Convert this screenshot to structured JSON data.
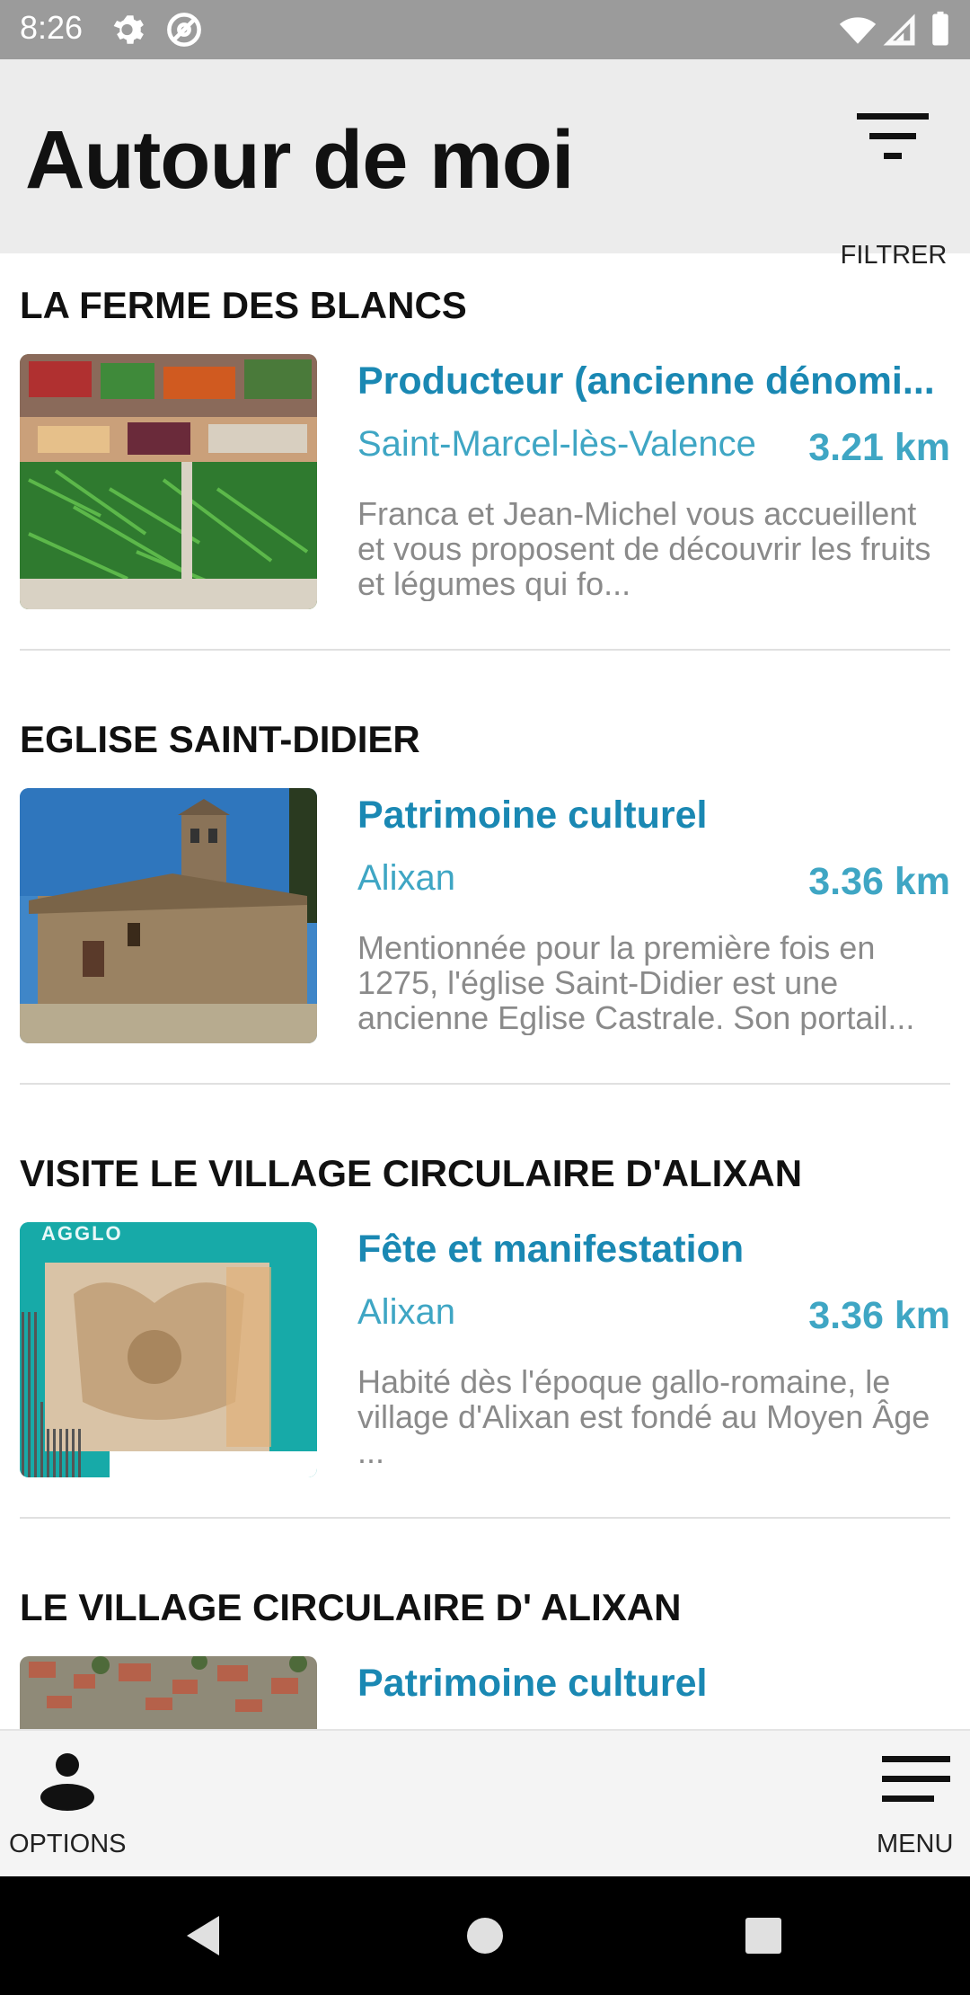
{
  "status_bar": {
    "time": "8:26",
    "icons": [
      "settings-icon",
      "at-sign-icon",
      "wifi-icon",
      "signal-icon",
      "battery-icon"
    ]
  },
  "header": {
    "title": "Autour de moi",
    "filter_label": "FILTRER",
    "filter_icon": "filter-icon"
  },
  "colors": {
    "accent": "#1a88b3",
    "accent_light": "#3fa6c4",
    "header_bg": "#ececec",
    "status_bar_bg": "#9b9b9b"
  },
  "items": [
    {
      "title": "LA FERME DES BLANCS",
      "category": "Producteur (ancienne dénomi...",
      "location": "Saint-Marcel-lès-Valence",
      "distance": "3.21 km",
      "description": "Franca et Jean-Michel vous accueillent et vous proposent de découvrir les fruits et légumes qui fo..."
    },
    {
      "title": "EGLISE SAINT-DIDIER",
      "category": "Patrimoine culturel",
      "location": "Alixan",
      "distance": "3.36 km",
      "description": "Mentionnée pour la première fois en 1275, l'église Saint-Didier est une ancienne Eglise Castrale. Son portail..."
    },
    {
      "title": "VISITE LE VILLAGE CIRCULAIRE D'ALIXAN",
      "category": "Fête et manifestation",
      "location": "Alixan",
      "distance": "3.36 km",
      "description": "Habité dès l'époque gallo-romaine, le village d'Alixan est fondé au Moyen Âge ...",
      "image_text": "AGGLO"
    },
    {
      "title": "LE VILLAGE CIRCULAIRE D' ALIXAN",
      "category": "Patrimoine culturel"
    }
  ],
  "bottom_nav": {
    "options_label": "OPTIONS",
    "menu_label": "MENU"
  },
  "system_nav": [
    "back-icon",
    "home-icon",
    "recents-icon"
  ]
}
